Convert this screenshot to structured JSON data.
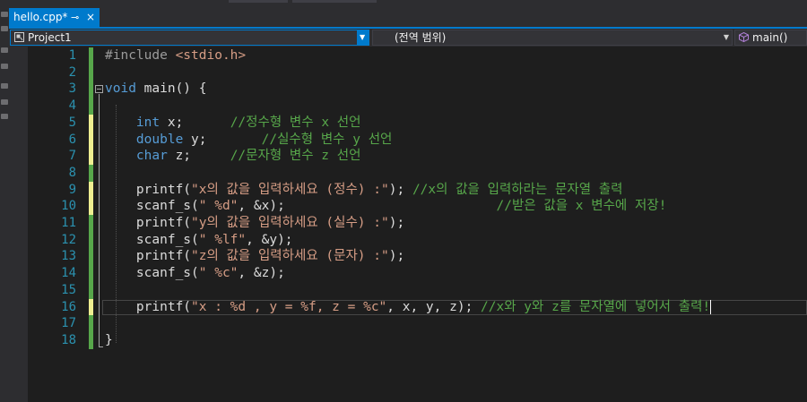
{
  "tab": {
    "title": "hello.cpp*",
    "pin_icon": "pin-icon",
    "close_icon": "close-icon"
  },
  "navbar": {
    "project": "Project1",
    "scope": "(전역 범위)",
    "member": "main()"
  },
  "editor": {
    "line_numbers": [
      "1",
      "2",
      "3",
      "4",
      "5",
      "6",
      "7",
      "8",
      "9",
      "10",
      "11",
      "12",
      "13",
      "14",
      "15",
      "16",
      "17",
      "18"
    ],
    "lines": [
      {
        "segments": [
          {
            "t": "#include ",
            "c": "pp"
          },
          {
            "t": "<stdio.h>",
            "c": "inc"
          }
        ]
      },
      {
        "segments": []
      },
      {
        "segments": [
          {
            "t": "void",
            "c": "kw"
          },
          {
            "t": " main() {",
            "c": "tx"
          }
        ]
      },
      {
        "segments": []
      },
      {
        "segments": [
          {
            "t": "    ",
            "c": "tx"
          },
          {
            "t": "int",
            "c": "kw"
          },
          {
            "t": " x;      ",
            "c": "tx"
          },
          {
            "t": "//정수형 변수 x 선언",
            "c": "cmt"
          }
        ]
      },
      {
        "segments": [
          {
            "t": "    ",
            "c": "tx"
          },
          {
            "t": "double",
            "c": "kw"
          },
          {
            "t": " y;       ",
            "c": "tx"
          },
          {
            "t": "//실수형 변수 y 선언",
            "c": "cmt"
          }
        ]
      },
      {
        "segments": [
          {
            "t": "    ",
            "c": "tx"
          },
          {
            "t": "char",
            "c": "kw"
          },
          {
            "t": " z;     ",
            "c": "tx"
          },
          {
            "t": "//문자형 변수 z 선언",
            "c": "cmt"
          }
        ]
      },
      {
        "segments": []
      },
      {
        "segments": [
          {
            "t": "    printf(",
            "c": "tx"
          },
          {
            "t": "\"x의 값을 입력하세요 (정수) :\"",
            "c": "str"
          },
          {
            "t": "); ",
            "c": "tx"
          },
          {
            "t": "//x의 값을 입력하라는 문자열 출력",
            "c": "cmt"
          }
        ]
      },
      {
        "segments": [
          {
            "t": "    scanf_s(",
            "c": "tx"
          },
          {
            "t": "\" %d\"",
            "c": "str"
          },
          {
            "t": ", &x);                           ",
            "c": "tx"
          },
          {
            "t": "//받은 값을 x 변수에 저장!",
            "c": "cmt"
          }
        ]
      },
      {
        "segments": [
          {
            "t": "    printf(",
            "c": "tx"
          },
          {
            "t": "\"y의 값을 입력하세요 (실수) :\"",
            "c": "str"
          },
          {
            "t": ");",
            "c": "tx"
          }
        ]
      },
      {
        "segments": [
          {
            "t": "    scanf_s(",
            "c": "tx"
          },
          {
            "t": "\" %lf\"",
            "c": "str"
          },
          {
            "t": ", &y);",
            "c": "tx"
          }
        ]
      },
      {
        "segments": [
          {
            "t": "    printf(",
            "c": "tx"
          },
          {
            "t": "\"z의 값을 입력하세요 (문자) :\"",
            "c": "str"
          },
          {
            "t": ");",
            "c": "tx"
          }
        ]
      },
      {
        "segments": [
          {
            "t": "    scanf_s(",
            "c": "tx"
          },
          {
            "t": "\" %c\"",
            "c": "str"
          },
          {
            "t": ", &z);",
            "c": "tx"
          }
        ]
      },
      {
        "segments": []
      },
      {
        "segments": [
          {
            "t": "    printf(",
            "c": "tx"
          },
          {
            "t": "\"x : %d , y = %f, z = %c\"",
            "c": "str"
          },
          {
            "t": ", x, y, z); ",
            "c": "tx"
          },
          {
            "t": "//x와 y와 z를 문자열에 넣어서 출력!",
            "c": "cmt"
          }
        ]
      },
      {
        "segments": []
      },
      {
        "segments": [
          {
            "t": "}",
            "c": "tx"
          }
        ]
      }
    ],
    "change_markers": [
      "saved",
      "saved",
      "saved",
      "saved",
      "unsaved",
      "unsaved",
      "unsaved",
      "saved",
      "unsaved",
      "unsaved",
      "saved",
      "saved",
      "saved",
      "saved",
      "saved",
      "unsaved",
      "saved",
      "saved"
    ],
    "caret_line": 16
  },
  "colors": {
    "accent": "#007acc",
    "background": "#1e1e1e",
    "keyword": "#569cd6",
    "string": "#d69d85",
    "comment": "#57a64a",
    "line_number": "#2b91af"
  }
}
